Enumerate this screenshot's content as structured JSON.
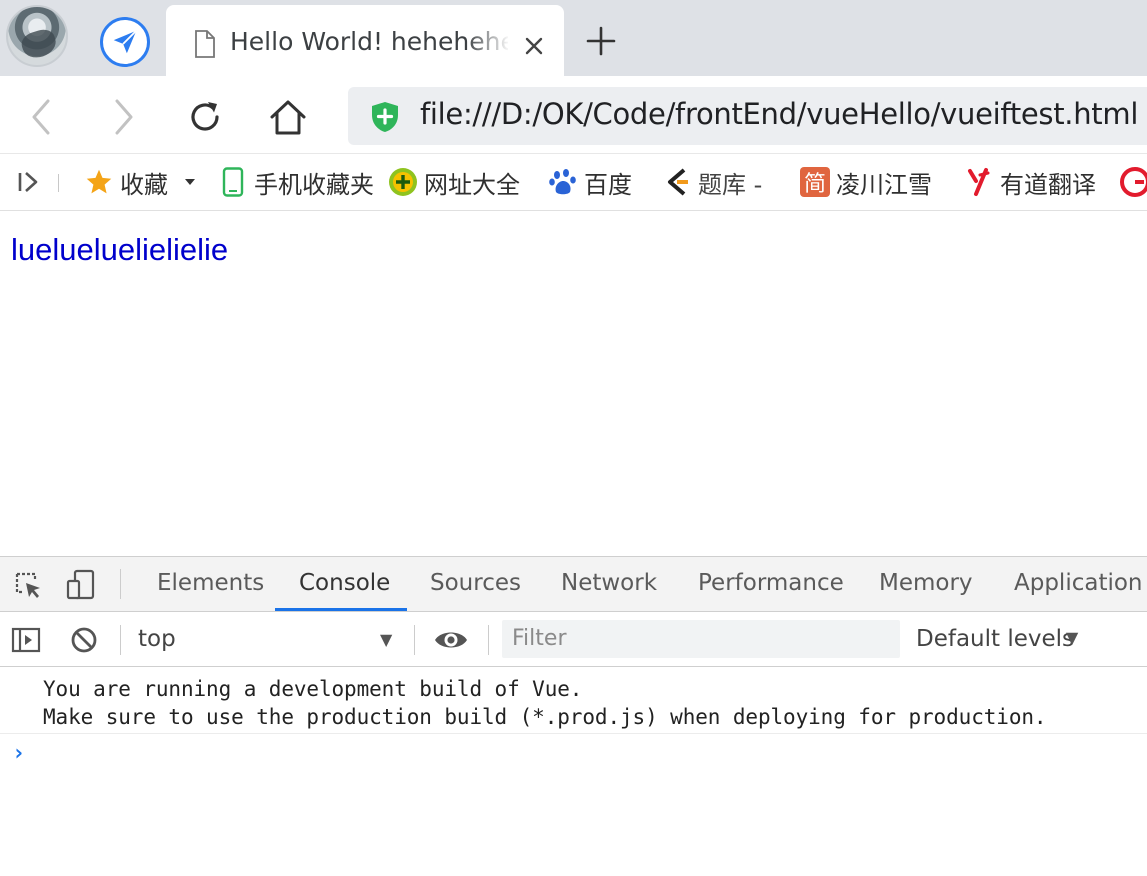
{
  "browser": {
    "tab": {
      "title": "Hello World! hehehehehe",
      "close_icon": "close-icon",
      "page_icon": "page-icon"
    },
    "new_tab_icon": "plus-icon",
    "toolbar": {
      "url": "file:///D:/OK/Code/frontEnd/vueHello/vueiftest.html",
      "secure_color": "#2fb55a"
    },
    "bookmarks": {
      "items": [
        {
          "label": "收藏",
          "icon": "star-icon"
        },
        {
          "label": "手机收藏夹",
          "icon": "phone-icon"
        },
        {
          "label": "网址大全",
          "icon": "plus-circle-icon"
        },
        {
          "label": "百度",
          "icon": "baidu-paw-icon"
        },
        {
          "label": "题库 -",
          "icon": "tiku-icon"
        },
        {
          "label": "凌川江雪",
          "icon": "jian-icon"
        },
        {
          "label": "有道翻译",
          "icon": "youdao-icon"
        }
      ],
      "jian_char": "简"
    }
  },
  "page": {
    "text": "luelueluelielielie"
  },
  "devtools": {
    "tabs": [
      "Elements",
      "Console",
      "Sources",
      "Network",
      "Performance",
      "Memory",
      "Application"
    ],
    "active_tab": "Console",
    "console": {
      "context": "top",
      "filter_placeholder": "Filter",
      "levels": "Default levels",
      "messages": [
        "You are running a development build of Vue.",
        "Make sure to use the production build (*.prod.js) when deploying for production."
      ],
      "prompt": "›"
    },
    "accent_color": "#1a73e8"
  }
}
